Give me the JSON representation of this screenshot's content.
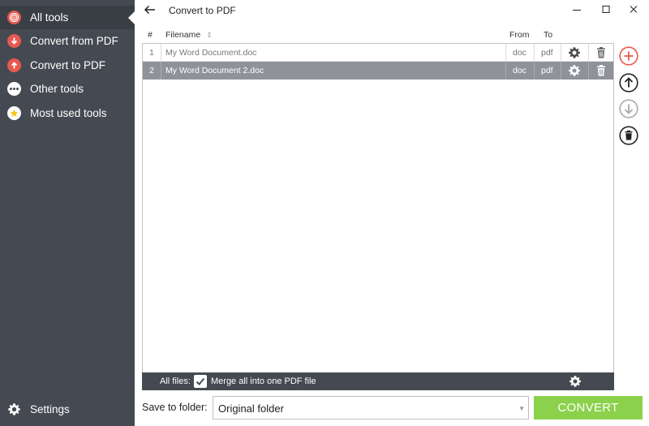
{
  "sidebar": {
    "items": [
      {
        "label": "All tools",
        "icon": "target-icon",
        "color": "#e8584f"
      },
      {
        "label": "Convert from PDF",
        "icon": "arrow-down-icon",
        "color": "#e8584f"
      },
      {
        "label": "Convert to PDF",
        "icon": "arrow-up-icon",
        "color": "#e8584f"
      },
      {
        "label": "Other tools",
        "icon": "ellipsis-icon",
        "color": "#ffffff"
      },
      {
        "label": "Most used tools",
        "icon": "star-icon",
        "color": "#f5c518"
      }
    ],
    "settings_label": "Settings"
  },
  "window": {
    "title": "Convert to PDF"
  },
  "table": {
    "headers": {
      "index": "#",
      "filename": "Filename",
      "from": "From",
      "to": "To"
    },
    "rows": [
      {
        "index": "1",
        "filename": "My Word Document.doc",
        "from": "doc",
        "to": "pdf",
        "selected": false
      },
      {
        "index": "2",
        "filename": "My Word Document 2.doc",
        "from": "doc",
        "to": "pdf",
        "selected": true
      }
    ]
  },
  "footer": {
    "all_files_label": "All files:",
    "merge_label": "Merge all into one PDF file",
    "merge_checked": true
  },
  "save": {
    "label": "Save to folder:",
    "folder_value": "Original folder"
  },
  "convert_label": "CONVERT",
  "colors": {
    "sidebar_bg": "#454a52",
    "selected_row": "#8f9399",
    "accent_red": "#e8584f",
    "convert_green": "#8bd14b"
  }
}
